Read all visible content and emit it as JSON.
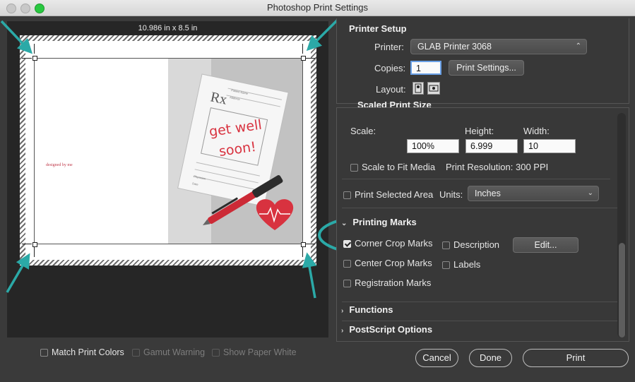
{
  "window": {
    "title": "Photoshop Print Settings"
  },
  "preview": {
    "size_label": "10.986 in x 8.5 in",
    "card": {
      "line1": "get well",
      "line2": "soon!",
      "rx": "Rx",
      "patient_name": "Patient Name",
      "address": "Address",
      "physician": "Physician",
      "date": "Date"
    },
    "designed_by": "designed by me"
  },
  "printer_setup": {
    "header": "Printer Setup",
    "printer_label": "Printer:",
    "printer_value": "GLAB Printer 3068",
    "copies_label": "Copies:",
    "copies_value": "1",
    "print_settings_button": "Print Settings...",
    "layout_label": "Layout:"
  },
  "scaled": {
    "partial_header": "Scaled Print Size",
    "scale_label": "Scale:",
    "height_label": "Height:",
    "width_label": "Width:",
    "scale_value": "100%",
    "height_value": "6.999",
    "width_value": "10",
    "scale_to_fit": "Scale to Fit Media",
    "resolution": "Print Resolution: 300 PPI"
  },
  "print_selected_area": "Print Selected Area",
  "units": {
    "label": "Units:",
    "value": "Inches"
  },
  "printing_marks": {
    "header": "Printing Marks",
    "corner_crop": "Corner Crop Marks",
    "center_crop": "Center Crop Marks",
    "registration": "Registration Marks",
    "description": "Description",
    "labels": "Labels",
    "edit_button": "Edit..."
  },
  "sections": {
    "functions": "Functions",
    "postscript": "PostScript Options"
  },
  "bottom_options": {
    "match_print_colors": "Match Print Colors",
    "gamut_warning": "Gamut Warning",
    "show_paper_white": "Show Paper White"
  },
  "buttons": {
    "cancel": "Cancel",
    "done": "Done",
    "print": "Print"
  },
  "colors": {
    "annotation_teal": "#2ba9a7",
    "heart_red": "#d8323f",
    "pen_red": "#cc2a36"
  }
}
